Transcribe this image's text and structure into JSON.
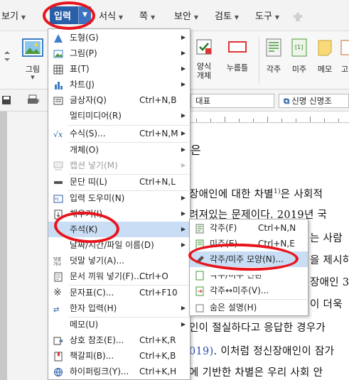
{
  "menubar": {
    "items": [
      {
        "label": "보기"
      },
      {
        "label": "입력",
        "active": true
      },
      {
        "label": "서식"
      },
      {
        "label": "쪽"
      },
      {
        "label": "보안"
      },
      {
        "label": "검토"
      },
      {
        "label": "도구"
      }
    ]
  },
  "ribbon": {
    "left_button": "그림",
    "form_button": "양식\n개체",
    "push_button": "누름틀",
    "footnote_button": "각주",
    "endnote_button": "미주",
    "memo_button": "메모",
    "hidden_button": "고"
  },
  "format_bar": {
    "style_combo": "대표",
    "font_combo": "신명 신명조"
  },
  "document": {
    "line1": "은",
    "line2": "장애인에 대한 차별",
    "line2_sup": "1)",
    "line2_tail": "은 사회적",
    "line3": "려져있는 문제이다. 2019년 국",
    "line4": "는 사람",
    "line5": "을 제시하",
    "line6": "장애인 3",
    "line7": "이 더욱",
    "line8": "인이 절실하다고 응답한 경우가",
    "line9_blue": "019)",
    "line9_tail": ". 이처럼 정신장애인이 잠가",
    "line10": "에 기반한 차별은 우리 사회 안"
  },
  "insert_menu": {
    "items": [
      {
        "label": "도형(G)",
        "submenu": true
      },
      {
        "label": "그림(P)",
        "submenu": true
      },
      {
        "label": "표(T)",
        "submenu": true
      },
      {
        "label": "차트(J)",
        "submenu": true
      },
      {
        "label": "글상자(Q)",
        "shortcut": "Ctrl+N,B"
      },
      {
        "label": "멀티미디어(R)",
        "submenu": true
      },
      {
        "label": "수식(S)...",
        "shortcut": "Ctrl+N,M",
        "submenu": true
      },
      {
        "label": "개체(O)",
        "submenu": true
      },
      {
        "label": "캡션 넣기(M)",
        "disabled": true,
        "submenu": true
      },
      {
        "label": "문단 띠(L)",
        "shortcut": "Ctrl+N,L"
      },
      {
        "label": "입력 도우미(N)",
        "submenu": true
      },
      {
        "label": "채우기(I)",
        "submenu": true
      },
      {
        "label": "주석(K)",
        "submenu": true,
        "highlighted": true
      },
      {
        "label": "날짜/시간/파일 이름(D)",
        "submenu": true
      },
      {
        "label": "덧말 넣기(A)..."
      },
      {
        "label": "문서 끼워 넣기(F)...",
        "shortcut": "Ctrl+O"
      },
      {
        "label": "문자표(C)...",
        "shortcut": "Ctrl+F10"
      },
      {
        "label": "한자 입력(H)",
        "submenu": true
      },
      {
        "label": "메모(U)",
        "submenu": true
      },
      {
        "label": "상호 참조(E)...",
        "shortcut": "Ctrl+K,R"
      },
      {
        "label": "책갈피(B)...",
        "shortcut": "Ctrl+K,B"
      },
      {
        "label": "하이퍼링크(Y)...",
        "shortcut": "Ctrl+K,H"
      }
    ]
  },
  "annotation_submenu": {
    "items": [
      {
        "label": "각주(F)",
        "shortcut": "Ctrl+N,N"
      },
      {
        "label": "미주(E)",
        "shortcut": "Ctrl+N,E"
      },
      {
        "label": "각주/미주 모양(N)...",
        "highlighted": true
      },
      {
        "label": "각주/미주 전환"
      },
      {
        "label": "각주↔미주(V)..."
      },
      {
        "label": "숨은 설명(H)"
      }
    ]
  },
  "colors": {
    "active_tab": "#2a5fa8",
    "menu_highlight": "#c9ddf4",
    "red_annotation": "#e8141b",
    "link_blue": "#2c4fb8"
  }
}
